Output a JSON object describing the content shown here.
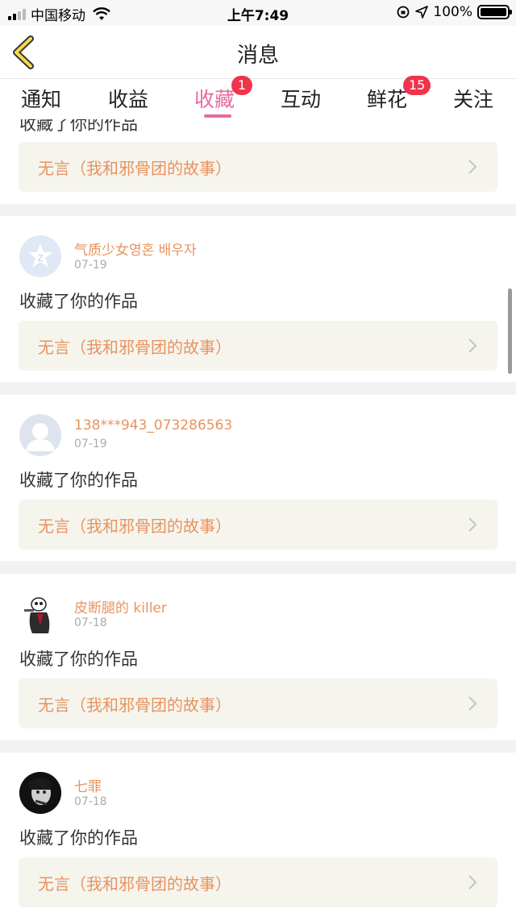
{
  "status_bar": {
    "carrier": "中国移动",
    "time": "上午7:49",
    "battery": "100%"
  },
  "header": {
    "title": "消息",
    "back_icon": "chevron-left-icon"
  },
  "tabs": [
    {
      "label": "通知",
      "active": false,
      "badge": ""
    },
    {
      "label": "收益",
      "active": false,
      "badge": ""
    },
    {
      "label": "收藏",
      "active": true,
      "badge": "1"
    },
    {
      "label": "互动",
      "active": false,
      "badge": ""
    },
    {
      "label": "鲜花",
      "active": false,
      "badge": "15"
    },
    {
      "label": "关注",
      "active": false,
      "badge": ""
    }
  ],
  "items": [
    {
      "user": "",
      "date": "",
      "action": "收藏了你的作品",
      "work": "无言（我和邪骨团的故事）",
      "avatar": "partial"
    },
    {
      "user": "气质少女영혼 배우자",
      "date": "07-19",
      "action": "收藏了你的作品",
      "work": "无言（我和邪骨团的故事）",
      "avatar": "qq-logo"
    },
    {
      "user": "138***943_073286563",
      "date": "07-19",
      "action": "收藏了你的作品",
      "work": "无言（我和邪骨团的故事）",
      "avatar": "default-user"
    },
    {
      "user": "皮断腿的 killer",
      "date": "07-18",
      "action": "收藏了你的作品",
      "work": "无言（我和邪骨团的故事）",
      "avatar": "cartoon-character"
    },
    {
      "user": "七罪",
      "date": "07-18",
      "action": "收藏了你的作品",
      "work": "无言（我和邪骨团的故事）",
      "avatar": "dark-photo"
    }
  ],
  "colors": {
    "accent_pink": "#e86a9e",
    "username_orange": "#e8935f",
    "badge_red": "#f0344b",
    "link_bg": "#f5f5ee"
  }
}
